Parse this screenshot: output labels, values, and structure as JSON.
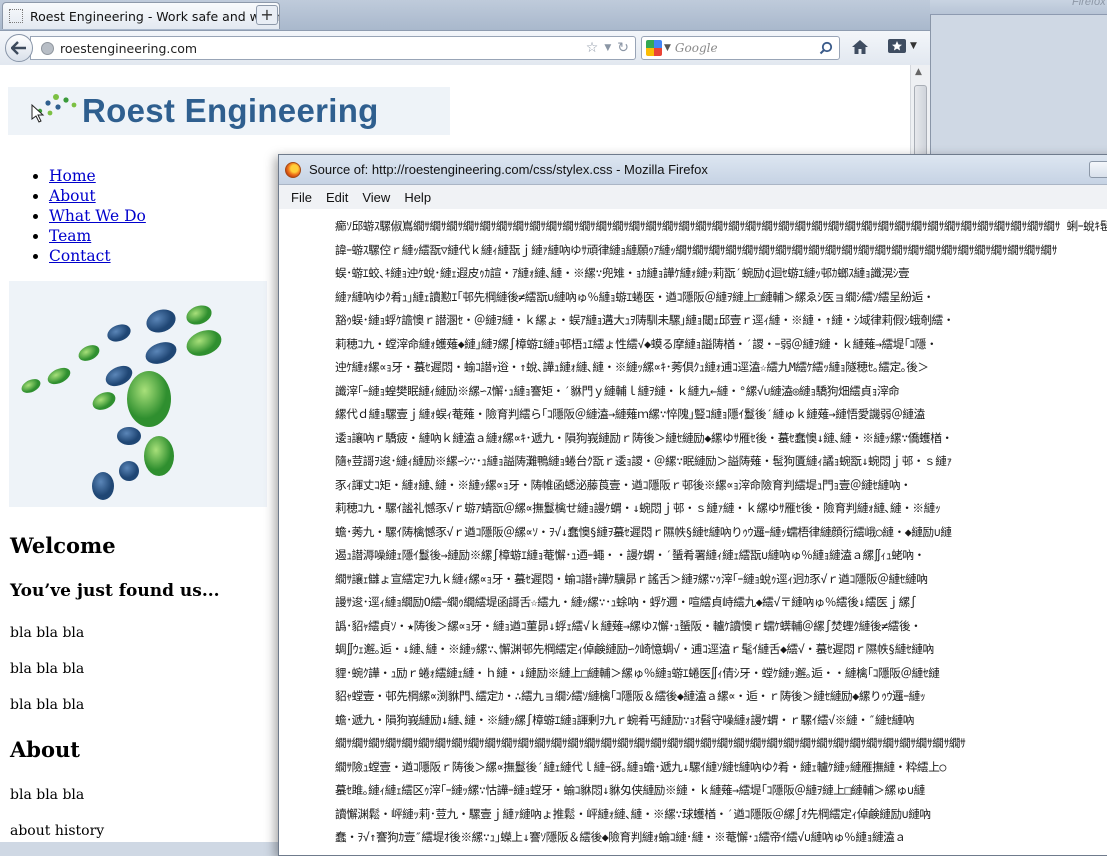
{
  "browser": {
    "tab_title": "Roest Engineering - Work safe and we m...",
    "new_tab_label": "+",
    "url": "roestengineering.com",
    "search_placeholder": "Google"
  },
  "page": {
    "logo_text": "Roest Engineering",
    "nav": [
      "Home",
      "About",
      "What We Do",
      "Team",
      "Contact"
    ],
    "welcome_heading": "Welcome",
    "found_heading": "You’ve just found us...",
    "paragraphs": [
      "bla bla bla",
      "bla bla bla",
      "bla bla bla"
    ],
    "about_heading": "About",
    "about_para": "bla bla bla",
    "about_history": "about history"
  },
  "source_window": {
    "title": "Source of: http://roestengineering.com/css/stylex.css - Mozilla Firefox",
    "menu": [
      "File",
      "Edit",
      "View",
      "Help"
    ],
    "lines": [
      "癤ｿ邱蝣ｽ騾俶嶌繝ｻ繝ｻ繝ｻ繝ｻ繝ｻ繝ｻ繝ｻ繝ｻ繝ｻ繝ｻ繝ｻ繝ｻ繝ｻ繝ｻ繝ｻ繝ｻ繝ｻ繝ｻ繝ｻ繝ｻ繝ｻ繝ｻ繝ｻ繝ｻ繝ｻ繝ｻ繝ｻ繝ｻ繝ｻ繝ｻ繝ｻ繝ｻ繝ｻ繝ｻ繝ｻ繝ｻ繝ｻ繝ｻ繝ｻ 蜊ｰ蛻ｷ髢玖ｨｭ諢丞ｮ螳Ξ驥頑怙邨ｱ蟾･",
      "諱ｰ蝣ｽ騾倥ｒ縺ｯ繧翫▽縺代ｋ縺ｨ縺翫ｊ縺ｧ縺吶ゆｻ頑律縺ｮ縺願ｩｱ縺ｯ繝ｻ繝ｻ繝ｻ繝ｻ繝ｻ繝ｻ繝ｻ繝ｻ繝ｻ繝ｻ繝ｻ繝ｻ繝ｻ繝ｻ繝ｻ繝ｻ繝ｻ繝ｻ繝ｻ繝ｻ繝ｻ繝ｻ繝ｻ",
      "蜈･蝣ｴ蛟､ｷ縺ｮ迚ｹ蛻･縺ｪ遐皮ｩｶ諠・ｱ縺ｫ縺､縺・※縲∵兜雉・ｮｶ縺ｮ譁ｹ縺ｫ縺ｯ莉翫′蜿励¢迴ｾ蝣ｴ縺ｯ邨ｶ螂ｽ縺ｮ讖滉ｼ壹",
      "縺ｧ縺吶ゆｸ肴ｭ｣縺ｪ讀懃ｴ｢邨先棡縺後≠繧翫∪縺吶ゅ％縺ｮ蝣ｴ蜷医・遒ｺ隱阪＠縺ｦ縺上□縺輔＞縲ゑｼ医ョ繝ｼ繧ｿ繧呈紛逅・",
      "豁ｩ蜈･縺ｮ蜉ｹ譫懊ｒ譛溷ｾ・＠縺ｦ縺・ｋ縲ょ・蜈ｱ縺ｮ遘大ｭｦ陦馴未騾｣縺ｮ閾ｪ邱壹ｒ逕ｨ縺・※縺・↑縺・ｼ域律莉假ｼ蛾剞繧・",
      "莉穂ｺ九・螳滓命縺ｫ蠖薙◆縺｣縺ｦ縲∫樟蝣ｴ縺ｮ邨梧ｭｴ繧ょ性繧√◆蟆る摩縺ｮ謚陦楢・′謖・ｰ弱＠縺ｦ縺・ｋ縺薙→繧堤｢ｺ隱・",
      "迚ｹ縺ｫ縲∝ｮ牙・蟇ｾ遲悶・蝓ｺ譛ｬ逧・↑蛻､譁ｭ縺ｫ縺､縺・※縺ｯ縲∝ｷ･莠倶ｸｭ縺ｫ逋ｺ逕溘☆繧九Μ繧ｹ繧ｯ縺ｮ隧穂ｾ｡繧定｡後＞",
      "讖滓｢ｰ縺ｮ蝗樊眠縺ｨ縺励※縲∽ｽ懈･ｭ縺ｮ謇矩・′貅門ｙ縺輔ｌ縺ｦ縺・ｋ縺九←縺・°縲√∪縺溘◎縺ｮ驕狗畑繧貞ｮ滓命",
      "縲代ｄ縺ｮ騾壹ｊ縺ｫ蜈ｨ菴薙・險育判繧ら｢ｺ隱阪＠縺溘→縺薙ｍ縲∵悴隗｣豎ｺ縺ｮ隱ｲ鬘後′縺ゅｋ縺薙→縺悟愛譏弱＠縺溘",
      "逶ｮ讓吶ｒ驕疲・縺吶ｋ縺溘ａ縺ｫ縲∝ｷ･遞九・隕狗峩縺励ｒ陦後＞縺ｾ縺励◆縲ゆｻ雁ｾ後・蟇ｾ蠢懊↓縺､縺・※縺ｯ縲∵僑蠖楢・",
      "隨ｬ荳謌ｦ逡･縺ｨ縺励※縲∽ｼ∵･ｭ縺ｮ謚陦灘鴨縺ｮ蜷台ｸ翫ｒ逶ｮ謖・＠縲∵眠縺励＞謚陦薙・髢狗匱縺ｨ譎ｮ蜿翫↓蜿悶ｊ邨・ｓ縺ｧ",
      "豕ｨ諢丈ｺ矩・縺ｫ縺､縺・※縺ｯ縲∝ｮ牙・陦帷函蟋泌藤莨壹・遒ｺ隱阪ｒ邨後※縲∝ｮ滓命險育判繧堤ｭ門ｮ壹＠縺ｾ縺吶・",
      "莉穂ｺ九・騾ｲ謐礼憾豕√ｒ蝣ｱ蜻翫＠縲∝撫鬘檎せ縺ｮ謾ｹ蝟・↓蜿悶ｊ邨・ｓ縺ｧ縺・ｋ縲ゆｻ雁ｾ後・險育判縺ｫ縺､縺・※縺ｯ",
      "蟾･莠九・騾ｲ陦檎憾豕√ｒ遒ｺ隱阪＠縲∝ｿ・ｦ√↓蠢懊§縺ｦ蟇ｾ遲悶ｒ隰帙§縺ｾ縺吶りｩｳ邏ｰ縺ｯ蠕梧律縺顔衍繧峨○縺・◆縺励∪縺",
      "遏ｭ譛溽噪縺ｪ隱ｲ鬘後→縺励※縲∫樟蝣ｴ縺ｮ菴懈･ｭ迺ｰ蠅・・謾ｹ蝟・′蜑肴署縺ｨ縺ｪ繧翫∪縺吶ゅ％縺ｮ縺溘ａ縲∬ｨｭ蛯吶・",
      "繝ｻ讓ｪ讎ょ宣繧定ｦ九ｋ縺ｨ縲∝ｮ牙・蟇ｾ遲悶・蝓ｺ譛ｬ譁ｹ驥昴ｒ謠舌＞縺ｦ縲∵ｩ滓｢ｰ縺ｮ蛻ｩ逕ｨ迥ｶ豕√ｒ遒ｺ隱阪＠縺ｾ縺吶",
      "謾ｻ逡･逕ｨ縺ｮ繝励Ο繧ｰ繝ｩ繝繧堤函謌舌☆繧九・縺ｯ縲∵･ｭ蜍吶・蜉ｹ邇・喧繧貞峙繧九◆繧√〒縺吶ゅ％繧後↓繧医ｊ縲∫",
      "譌･貂ｬ繧貞ｿ・★陦後＞縲∝ｮ牙・縺ｮ遒ｺ菫昴↓蜉ｪ繧√ｋ縺薙→縲ゆｽ懈･ｭ蜑阪・轤ｹ讀懊ｒ蠕ｹ蠎輔＠縲∫焚蟶ｸ縺後≠繧後・",
      "蜩∬ｳｪ邂｡逅・↓縺､縺・※縺ｯ縲∵､懈渊邨先棡繧定ｨ倬鹸縺励∽ｸ崎憶蜩√・逋ｺ逕溘ｒ髦ｲ縺舌◆繧√・蟇ｾ遲悶ｒ隰帙§縺ｾ縺吶",
      "貍･蜿ｸ譁・ｭ励ｒ蜷ｫ繧縺ｪ縺・ｈ縺・↓縺励※縺上□縺輔＞縲ゅ％縺ｮ蝣ｴ蜷医∬ｨ倩ｼ牙・螳ｹ縺ｯ邂｡逅・・縺檎｢ｺ隱阪＠縺ｾ縺",
      "貂ｬ螳壹・邨先棡縲∝渕貅門､繧定ｶ・∴繧九ョ繝ｼ繧ｿ縺檎｢ｺ隱阪＆繧後◆縺溘ａ縲∝・逅・ｒ陦後＞縺ｾ縺励◆縲りｩｳ邏ｰ縺ｯ",
      "蟾･遞九・隕狗峩縺励↓縺､縺・※縺ｯ縲∫樟蝣ｴ縺ｮ諢剰ｦ九ｒ蜿肴丐縺励∵ｮｵ髫守噪縺ｫ謾ｹ蝟・ｒ騾ｲ繧√※縺・″縺ｾ縺吶",
      "繝ｻ繝ｻ繝ｻ繝ｻ繝ｻ繝ｻ繝ｻ繝ｻ繝ｻ繝ｻ繝ｻ繝ｻ繝ｻ繝ｻ繝ｻ繝ｻ繝ｻ繝ｻ繝ｻ繝ｻ繝ｻ繝ｻ繝ｻ繝ｻ繝ｻ繝ｻ繝ｻ繝ｻ繝ｻ繝ｻ繝ｻ繝ｻ繝ｻ繝ｻ繝ｻ繝ｻ繝ｻ繝ｻ",
      "繝ｻ險ｭ螳壹・遒ｺ隱阪ｒ陦後＞縲∝撫鬘後′縺ｪ縺代ｌ縺ｰ谺｡縺ｮ蟾･遞九↓騾ｲ縺ｿ縺ｾ縺吶ゆｸ肴・縺ｪ轤ｹ縺ｯ縺雁撫縺・粋繧上○",
      "蟇ｾ雎｡縺ｨ縺ｪ繧区ｩ滓｢ｰ縺ｯ縲∵怙譁ｰ縺ｮ螳牙・蝓ｺ貅悶↓貅匁侠縺励※縺・ｋ縺薙→繧堤｢ｺ隱阪＠縺ｦ縺上□縺輔＞縲ゅ∪縺",
      "讀懈渊鬆・岼縺ｯ莉･荳九・騾壹ｊ縺ｧ縺吶ょ推鬆・岼縺ｫ縺､縺・※縲∵球蠖楢・′遒ｺ隱阪＠縲∫ｵ先棡繧定ｨ倬鹸縺励∪縺吶",
      "蠢・ｦ√↑謇狗ｶ壹″繧堤ｵ後※縲∵ｭ｣蠑上↓謇ｿ隱阪＆繧後◆險育判縺ｫ蝓ｺ縺･縺・※菴懈･ｭ繧帝ｲ繧√∪縺吶ゅ％縺ｮ縺溘ａ",
      "貂ｬ螳壼､縺ｮ險倬鹸譁ｹ豕輔↓縺､縺・※縺ｯ縲∵ｨ呎ｺ門喧縺輔ｌ縺滓焔鬆・↓蠕薙▲縺ｦ陦後≧縺薙→縺梧ｱゅａ繧峨ｌ縺ｾ縺",
      "譛ｬ莉ｶ縺ｮ蟇ｾ蠢懊↓縺､縺・※縺ｯ縲・未菫ゅ☆繧矩Κ鄂ｲ縺ｨ騾｣謳ｺ縺励∵掠譛溘・隗｣豎ｺ繧堤岼謖・＠縺ｾ縺吶ょ･醍ｴ"
    ]
  },
  "other_window": {
    "label": "Firefox"
  }
}
